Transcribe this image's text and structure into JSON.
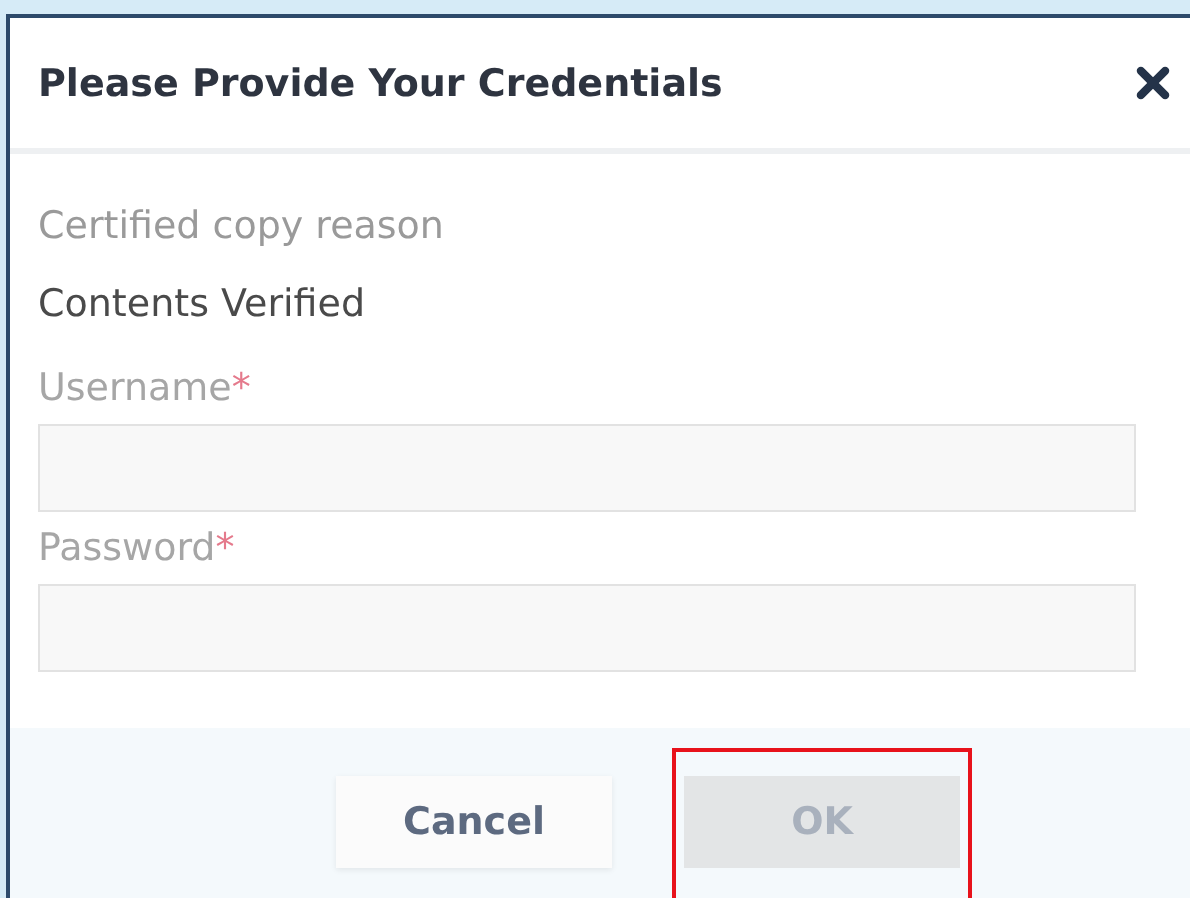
{
  "dialog": {
    "title": "Please Provide Your Credentials"
  },
  "reason": {
    "label": "Certified copy reason",
    "value": "Contents Verified"
  },
  "fields": [
    {
      "label": "Username",
      "required_mark": "*"
    },
    {
      "label": "Password",
      "required_mark": "*"
    }
  ],
  "buttons": [
    {
      "label": "Cancel",
      "disabled": false,
      "highlighted": false
    },
    {
      "label": "OK",
      "disabled": true,
      "highlighted": true
    }
  ]
}
